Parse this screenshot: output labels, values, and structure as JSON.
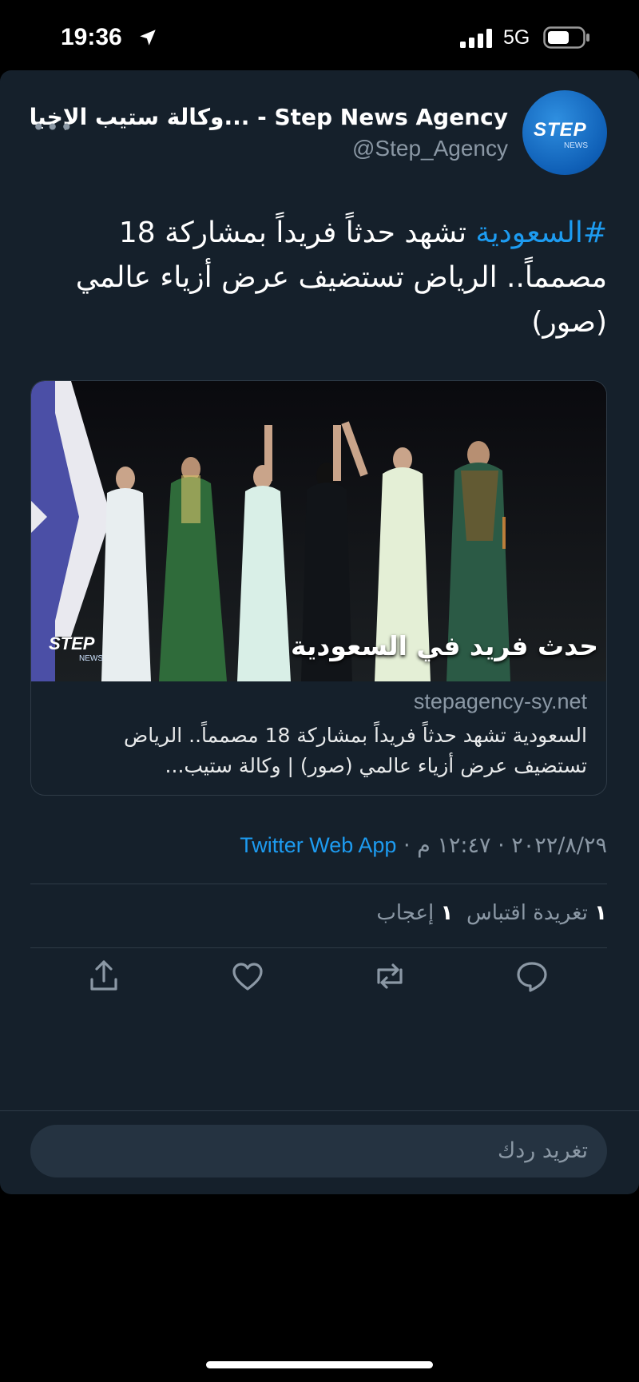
{
  "status_bar": {
    "time": "19:36",
    "network": "5G",
    "icons": [
      "location-arrow-icon",
      "signal-bars-icon",
      "battery-icon"
    ]
  },
  "tweet": {
    "avatar_text": "STEP",
    "avatar_subtext": "NEWS",
    "display_name": "وكالة ستيب الإخبا... - Step News Agency",
    "handle": "@Step_Agency",
    "hashtag": "#السعودية",
    "text": " تشهد حدثاً فريداً بمشاركة 18 مصمماً.. الرياض تستضيف عرض أزياء عالمي (صور)",
    "link_card": {
      "image_caption": "حدث فريد في السعودية",
      "image_logo": "STEP",
      "image_logo_sub": "NEWS",
      "domain": "stepagency-sy.net",
      "description": "السعودية تشهد حدثاً فريداً بمشاركة 18 مصمماً.. الرياض تستضيف عرض أزياء عالمي (صور) | وكالة ستيب..."
    },
    "date": "٢٠٢٢/٨/٢٩",
    "time": "١٢:٤٧ م",
    "separator": " · ",
    "source": "Twitter Web App",
    "stats": {
      "retweets_count": "١",
      "retweets_label": "تغريدة اقتباس",
      "likes_count": "١",
      "likes_label": "إعجاب"
    },
    "actions": [
      "reply-icon",
      "retweet-icon",
      "like-icon",
      "share-icon"
    ]
  },
  "reply": {
    "placeholder": "تغريد ردك"
  },
  "colors": {
    "background": "#15202b",
    "accent": "#1d9bf0",
    "muted": "#8b98a5"
  }
}
